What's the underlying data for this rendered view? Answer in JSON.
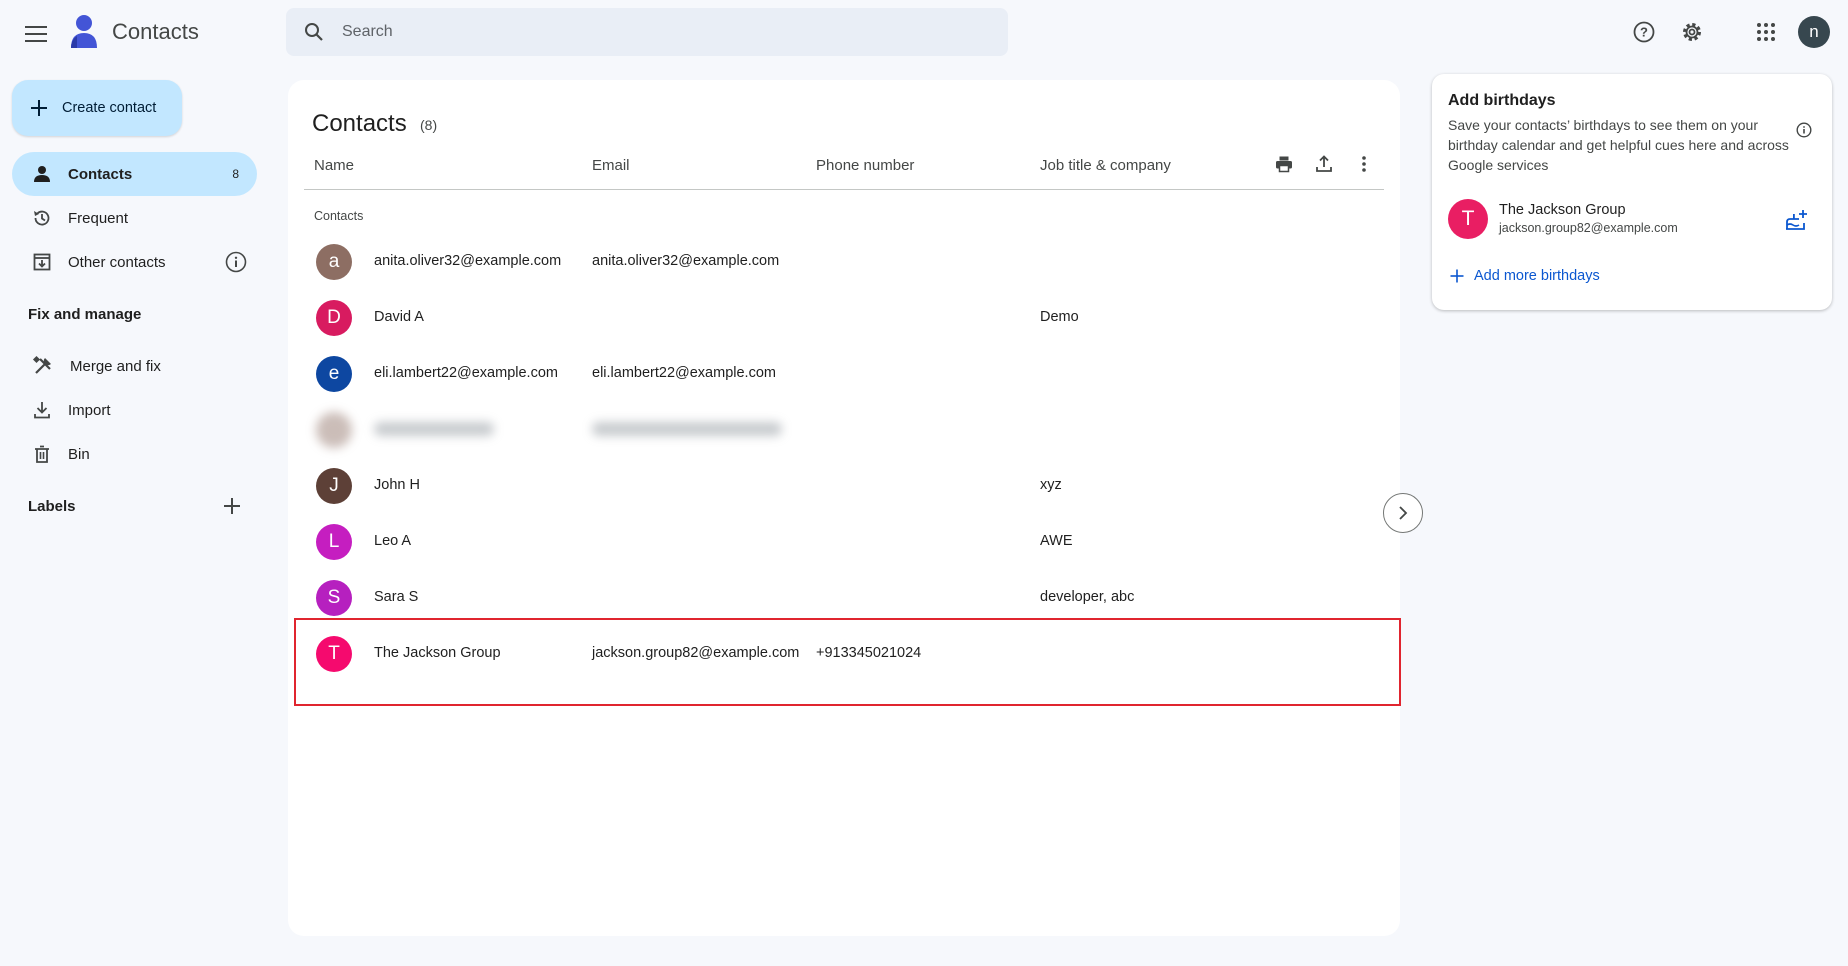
{
  "header": {
    "app_title": "Contacts",
    "search_placeholder": "Search",
    "avatar_letter": "n"
  },
  "sidebar": {
    "create_label": "Create contact",
    "items": [
      {
        "label": "Contacts",
        "count": "8"
      },
      {
        "label": "Frequent"
      },
      {
        "label": "Other contacts"
      }
    ],
    "fix_header": "Fix and manage",
    "fix_items": [
      {
        "label": "Merge and fix"
      },
      {
        "label": "Import"
      },
      {
        "label": "Bin"
      }
    ],
    "labels_header": "Labels"
  },
  "list": {
    "title": "Contacts",
    "count": "(8)",
    "columns": {
      "name": "Name",
      "email": "Email",
      "phone": "Phone number",
      "job": "Job title & company"
    },
    "section_label": "Contacts",
    "rows": [
      {
        "initial": "a",
        "color": "#8d6e63",
        "name": "anita.oliver32@example.com",
        "email": "anita.oliver32@example.com",
        "phone": "",
        "job": ""
      },
      {
        "initial": "D",
        "color": "#d81b60",
        "name": "David A",
        "email": "",
        "phone": "",
        "job": "Demo"
      },
      {
        "initial": "e",
        "color": "#0d47a1",
        "name": "eli.lambert22@example.com",
        "email": "eli.lambert22@example.com",
        "phone": "",
        "job": ""
      },
      {
        "initial": "",
        "color": "#a1887f",
        "name": "",
        "email": "",
        "phone": "",
        "job": "",
        "blurred": true
      },
      {
        "initial": "J",
        "color": "#5d4037",
        "name": "John H",
        "email": "",
        "phone": "",
        "job": "xyz"
      },
      {
        "initial": "L",
        "color": "#c51ec0",
        "name": "Leo A",
        "email": "",
        "phone": "",
        "job": "AWE"
      },
      {
        "initial": "S",
        "color": "#b620bf",
        "name": "Sara S",
        "email": "",
        "phone": "",
        "job": "developer, abc"
      },
      {
        "initial": "T",
        "color": "#f50a6e",
        "name": "The Jackson Group",
        "email": "jackson.group82@example.com",
        "phone": "+913345021024",
        "job": ""
      }
    ]
  },
  "birthdays": {
    "title": "Add birthdays",
    "description": "Save your contacts’ birthdays to see them on your birthday calendar and get helpful cues here and across Google services",
    "contact_initial": "T",
    "contact_name": "The Jackson Group",
    "contact_email": "jackson.group82@example.com",
    "add_more_label": "Add more birthdays"
  },
  "colors": {
    "accent": "#c2e7ff",
    "link": "#0b57d0",
    "highlight": "#e0252f"
  }
}
